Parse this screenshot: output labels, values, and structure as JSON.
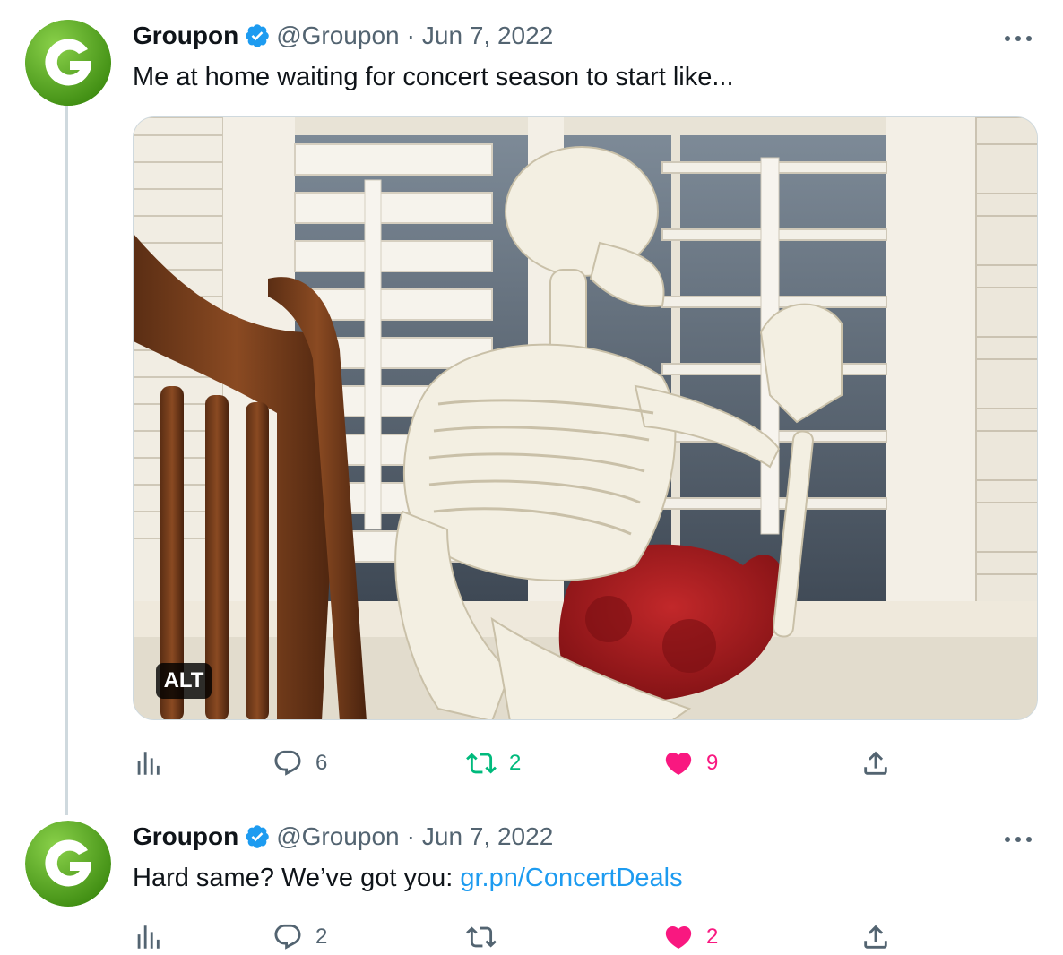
{
  "tweets": [
    {
      "author_name": "Groupon",
      "handle": "@Groupon",
      "separator": "·",
      "date": "Jun 7, 2022",
      "text": "Me at home waiting for concert season to start like...",
      "media": {
        "alt_badge": "ALT"
      },
      "stats": {
        "views": "",
        "replies": "6",
        "retweets": "2",
        "likes": "9"
      }
    },
    {
      "author_name": "Groupon",
      "handle": "@Groupon",
      "separator": "·",
      "date": "Jun 7, 2022",
      "text_prefix": "Hard same? We’ve got you: ",
      "link": "gr.pn/ConcertDeals",
      "stats": {
        "views": "",
        "replies": "2",
        "retweets": "",
        "likes": "2"
      }
    }
  ],
  "colors": {
    "brand_green": "#53a318",
    "verified_blue": "#1d9bf0",
    "retweet_green": "#00ba7c",
    "like_pink": "#f91880",
    "muted": "#536471"
  },
  "icons": [
    "groupon-logo",
    "verified-badge-icon",
    "more-icon",
    "views-icon",
    "reply-icon",
    "retweet-icon",
    "like-icon",
    "share-icon"
  ]
}
